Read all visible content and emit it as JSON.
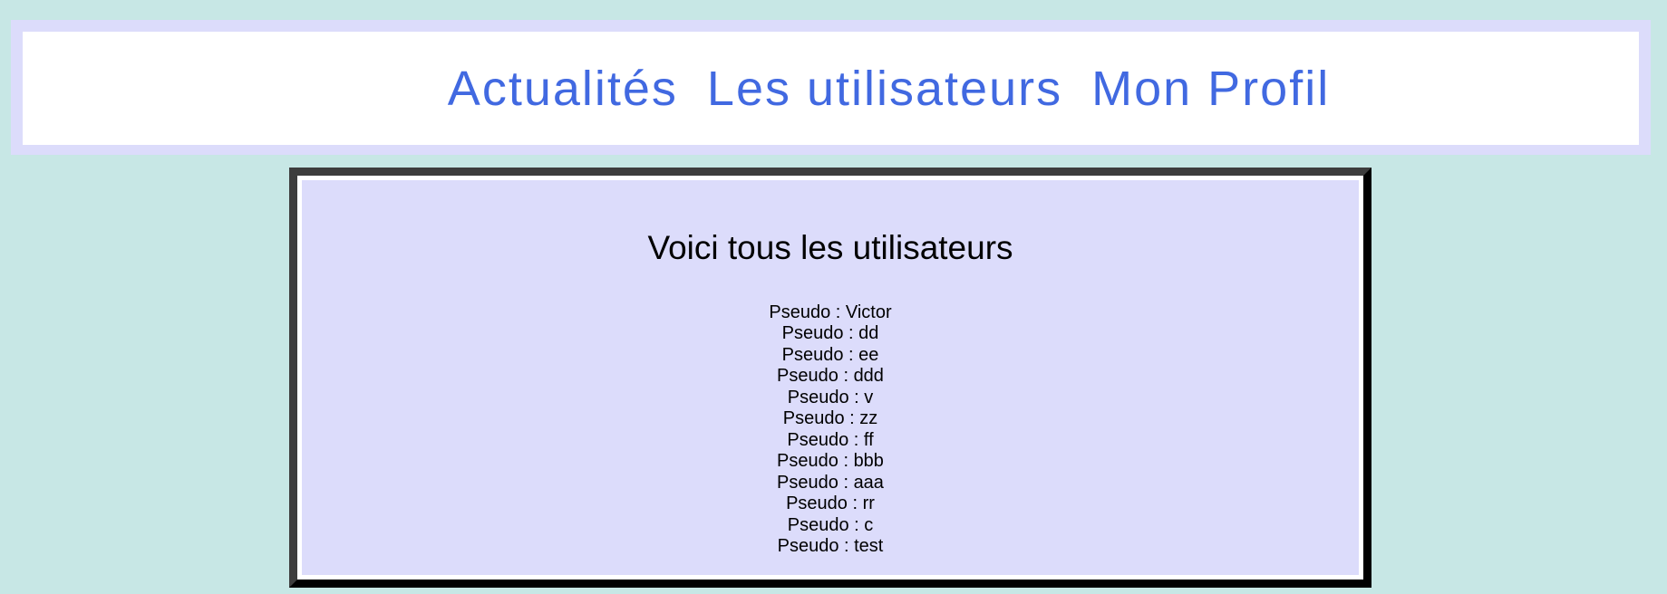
{
  "nav": {
    "links": [
      {
        "label": "Actualités"
      },
      {
        "label": "Les utilisateurs"
      },
      {
        "label": "Mon Profil"
      }
    ]
  },
  "main": {
    "title": "Voici tous les utilisateurs",
    "pseudo_label": "Pseudo",
    "users": [
      "Victor",
      "dd",
      "ee",
      "ddd",
      "v",
      "zz",
      "ff",
      "bbb",
      "aaa",
      "rr",
      "c",
      "test"
    ]
  },
  "colors": {
    "page_background": "#c7e7e5",
    "nav_frame": "#dcdcfb",
    "nav_link": "#4169e1",
    "content_background": "#dcdcfb",
    "content_border": "#3d3d3d"
  }
}
